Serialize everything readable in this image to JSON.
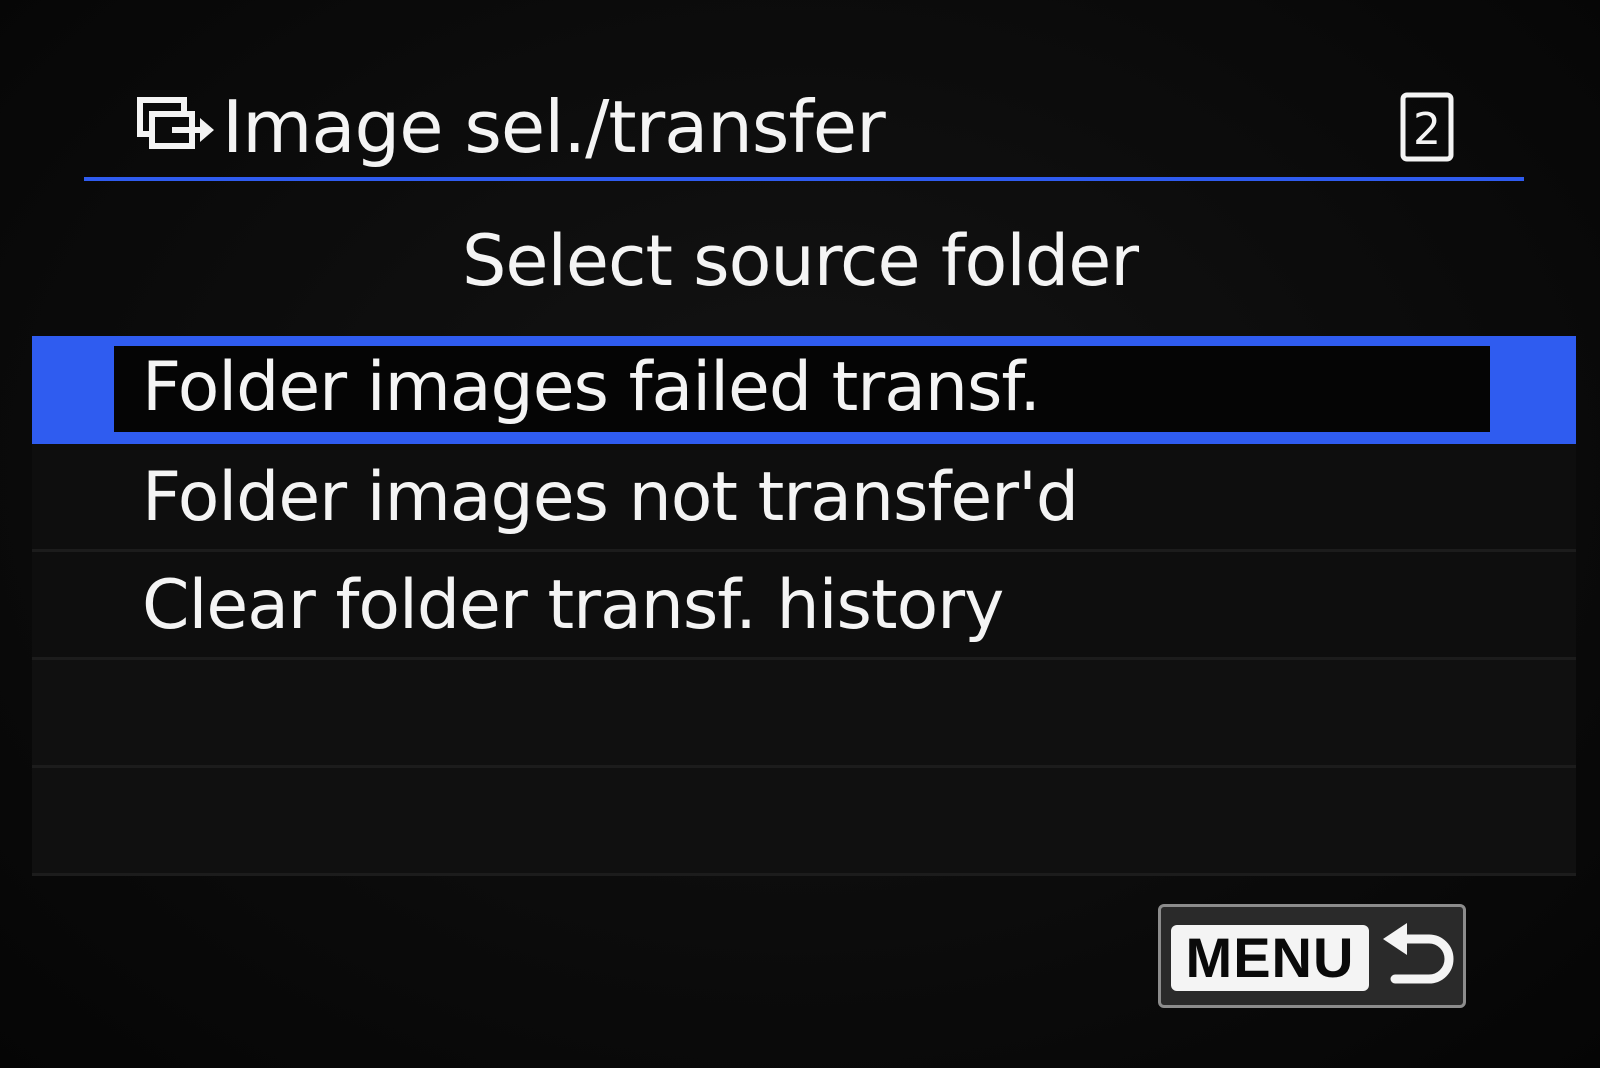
{
  "header": {
    "icon": "transfer-icon",
    "title": "Image sel./transfer",
    "page_badge": "2"
  },
  "subtitle": "Select source folder",
  "menu": {
    "items": [
      {
        "label": "Folder images failed transf.",
        "selected": true
      },
      {
        "label": "Folder images not transfer'd",
        "selected": false
      },
      {
        "label": "Clear folder transf. history",
        "selected": false
      }
    ]
  },
  "back_button": {
    "label": "MENU",
    "icon": "return-arrow-icon"
  },
  "colors": {
    "accent": "#2f5cf0",
    "background": "#0b0b0b",
    "text": "#f4f4f4"
  }
}
